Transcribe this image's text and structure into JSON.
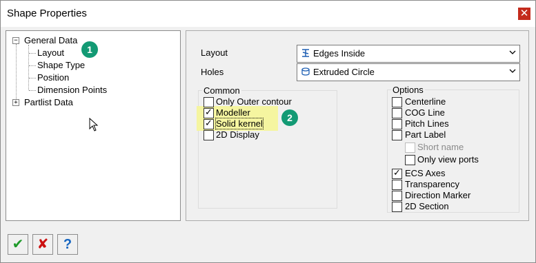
{
  "window": {
    "title": "Shape Properties",
    "close_glyph": "✕"
  },
  "tree": {
    "items": [
      {
        "label": "General Data",
        "expander": "−"
      },
      {
        "label": "Layout"
      },
      {
        "label": "Shape Type"
      },
      {
        "label": "Position"
      },
      {
        "label": "Dimension Points"
      },
      {
        "label": "Partlist Data",
        "expander": "+"
      }
    ]
  },
  "badges": [
    "1",
    "2"
  ],
  "fields": {
    "layout": {
      "label": "Layout",
      "value": "Edges Inside",
      "icon": "edges-inside-icon"
    },
    "holes": {
      "label": "Holes",
      "value": "Extruded Circle",
      "icon": "extruded-circle-icon"
    }
  },
  "common": {
    "title": "Common",
    "items": [
      {
        "label": "Only Outer contour",
        "checked": false
      },
      {
        "label": "Modeller",
        "checked": true
      },
      {
        "label": "Solid kernel",
        "checked": true
      },
      {
        "label": "2D Display",
        "checked": false
      }
    ]
  },
  "options": {
    "title": "Options",
    "items": [
      {
        "label": "Centerline",
        "checked": false
      },
      {
        "label": "COG Line",
        "checked": false
      },
      {
        "label": "Pitch Lines",
        "checked": false
      },
      {
        "label": "Part Label",
        "checked": false
      },
      {
        "label": "Short name",
        "checked": false,
        "disabled": true
      },
      {
        "label": "Only view ports",
        "checked": false
      },
      {
        "label": "ECS Axes",
        "checked": true
      },
      {
        "label": "Transparency",
        "checked": false
      },
      {
        "label": "Direction Marker",
        "checked": false
      },
      {
        "label": "2D Section",
        "checked": false
      }
    ]
  },
  "toolbar": {
    "ok_icon": "✔",
    "cancel_icon": "✘",
    "help_icon": "?",
    "colors": {
      "ok": "#1f9a2a",
      "cancel": "#cc1010",
      "help": "#1565c0"
    }
  },
  "highlight_color": "#f5f5a0",
  "badge_color": "#139a74"
}
